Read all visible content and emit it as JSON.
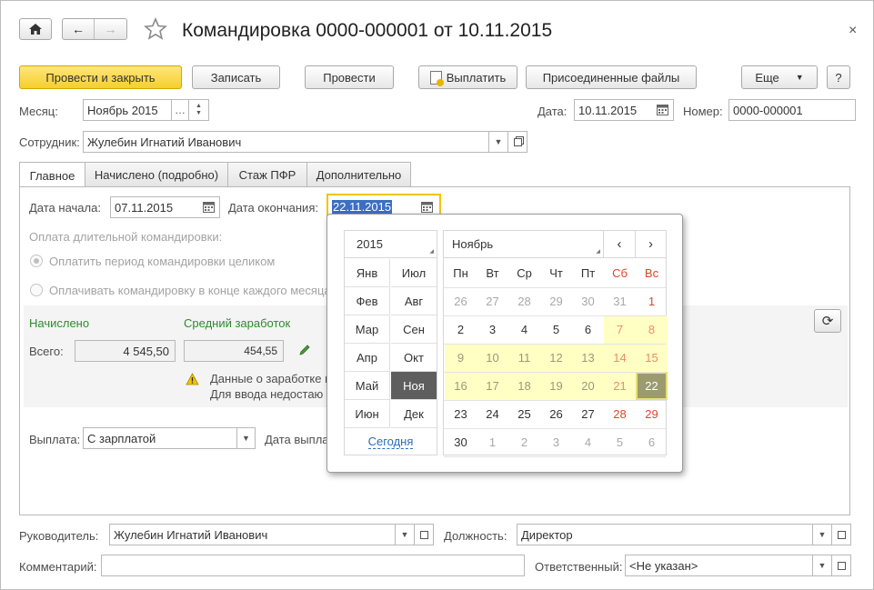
{
  "window": {
    "title": "Командировка 0000-000001 от 10.11.2015"
  },
  "toolbar": {
    "post_close": "Провести и закрыть",
    "save": "Записать",
    "post": "Провести",
    "pay": "Выплатить",
    "attached_files": "Присоединенные файлы",
    "more": "Еще",
    "help": "?"
  },
  "header": {
    "month_label": "Месяц:",
    "month_value": "Ноябрь 2015",
    "date_label": "Дата:",
    "date_value": "10.11.2015",
    "number_label": "Номер:",
    "number_value": "0000-000001",
    "employee_label": "Сотрудник:",
    "employee_value": "Жулебин Игнатий Иванович"
  },
  "tabs": [
    {
      "label": "Главное"
    },
    {
      "label": "Начислено (подробно)"
    },
    {
      "label": "Стаж ПФР"
    },
    {
      "label": "Дополнительно"
    }
  ],
  "main": {
    "start_label": "Дата начала:",
    "start_value": "07.11.2015",
    "end_label": "Дата окончания:",
    "end_value": "22.11.2015",
    "payment_long_label": "Оплата длительной командировки:",
    "option_whole": "Оплатить период командировки целиком",
    "option_monthly": "Оплачивать командировку в конце каждого месяца",
    "accrued_heading": "Начислено",
    "avg_heading": "Средний заработок",
    "total_label": "Всего:",
    "total_value": "4 545,50",
    "avg_value": "454,55",
    "warning_line1": "Данные о заработке н",
    "warning_line2": "Для ввода недостаю",
    "payout_label": "Выплата:",
    "payout_value": "С зарплатой",
    "payout_date_label": "Дата выпла"
  },
  "footer": {
    "manager_label": "Руководитель:",
    "manager_value": "Жулебин Игнатий Иванович",
    "position_label": "Должность:",
    "position_value": "Директор",
    "comment_label": "Комментарий:",
    "comment_value": "",
    "responsible_label": "Ответственный:",
    "responsible_value": "<Не указан>"
  },
  "calendar": {
    "year": "2015",
    "month": "Ноябрь",
    "months": [
      "Янв",
      "Июл",
      "Фев",
      "Авг",
      "Мар",
      "Сен",
      "Апр",
      "Окт",
      "Май",
      "Ноя",
      "Июн",
      "Дек"
    ],
    "selected_month": "Ноя",
    "today_label": "Сегодня",
    "weekdays": [
      "Пн",
      "Вт",
      "Ср",
      "Чт",
      "Пт",
      "Сб",
      "Вс"
    ],
    "weeks": [
      [
        "26",
        "27",
        "28",
        "29",
        "30",
        "31",
        "1"
      ],
      [
        "2",
        "3",
        "4",
        "5",
        "6",
        "7",
        "8"
      ],
      [
        "9",
        "10",
        "11",
        "12",
        "13",
        "14",
        "15"
      ],
      [
        "16",
        "17",
        "18",
        "19",
        "20",
        "21",
        "22"
      ],
      [
        "23",
        "24",
        "25",
        "26",
        "27",
        "28",
        "29"
      ],
      [
        "30",
        "1",
        "2",
        "3",
        "4",
        "5",
        "6"
      ]
    ],
    "range_start": "7",
    "range_end": "22",
    "selected_day": "22",
    "colors": {
      "weekend": "#e0452c",
      "range_bg": "#ffffc4",
      "selected_bg": "#9b9b6f",
      "link": "#2a6ebb"
    }
  }
}
